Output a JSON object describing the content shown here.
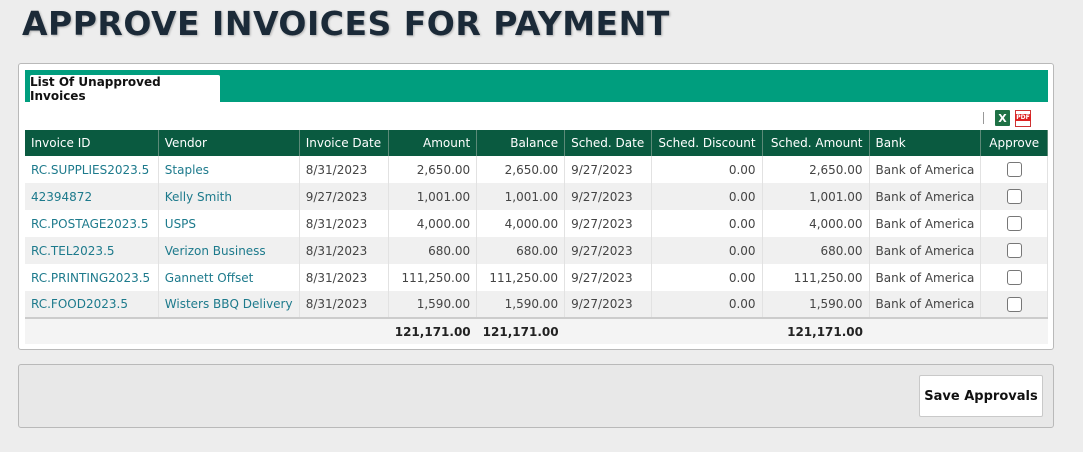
{
  "page": {
    "title": "APPROVE INVOICES FOR PAYMENT"
  },
  "tabs": [
    {
      "label": "List Of Unapproved Invoices"
    }
  ],
  "export": {
    "xls_icon": "excel-icon",
    "pdf_icon": "pdf-icon",
    "xls_glyph": "X",
    "pdf_glyph": "PDF"
  },
  "table": {
    "headers": {
      "invoice_id": "Invoice ID",
      "vendor": "Vendor",
      "invoice_date": "Invoice Date",
      "amount": "Amount",
      "balance": "Balance",
      "sched_date": "Sched. Date",
      "sched_discount": "Sched. Discount",
      "sched_amount": "Sched. Amount",
      "bank": "Bank",
      "approve": "Approve"
    },
    "rows": [
      {
        "invoice_id": "RC.SUPPLIES2023.5",
        "vendor": "Staples",
        "invoice_date": "8/31/2023",
        "amount": "2,650.00",
        "balance": "2,650.00",
        "sched_date": "9/27/2023",
        "sched_discount": "0.00",
        "sched_amount": "2,650.00",
        "bank": "Bank of America",
        "approved": false
      },
      {
        "invoice_id": "42394872",
        "vendor": "Kelly Smith",
        "invoice_date": "9/27/2023",
        "amount": "1,001.00",
        "balance": "1,001.00",
        "sched_date": "9/27/2023",
        "sched_discount": "0.00",
        "sched_amount": "1,001.00",
        "bank": "Bank of America",
        "approved": false
      },
      {
        "invoice_id": "RC.POSTAGE2023.5",
        "vendor": "USPS",
        "invoice_date": "8/31/2023",
        "amount": "4,000.00",
        "balance": "4,000.00",
        "sched_date": "9/27/2023",
        "sched_discount": "0.00",
        "sched_amount": "4,000.00",
        "bank": "Bank of America",
        "approved": false
      },
      {
        "invoice_id": "RC.TEL2023.5",
        "vendor": "Verizon Business",
        "invoice_date": "8/31/2023",
        "amount": "680.00",
        "balance": "680.00",
        "sched_date": "9/27/2023",
        "sched_discount": "0.00",
        "sched_amount": "680.00",
        "bank": "Bank of America",
        "approved": false
      },
      {
        "invoice_id": "RC.PRINTING2023.5",
        "vendor": "Gannett Offset",
        "invoice_date": "8/31/2023",
        "amount": "111,250.00",
        "balance": "111,250.00",
        "sched_date": "9/27/2023",
        "sched_discount": "0.00",
        "sched_amount": "111,250.00",
        "bank": "Bank of America",
        "approved": false
      },
      {
        "invoice_id": "RC.FOOD2023.5",
        "vendor": "Wisters BBQ Delivery",
        "invoice_date": "8/31/2023",
        "amount": "1,590.00",
        "balance": "1,590.00",
        "sched_date": "9/27/2023",
        "sched_discount": "0.00",
        "sched_amount": "1,590.00",
        "bank": "Bank of America",
        "approved": false
      }
    ],
    "totals": {
      "amount": "121,171.00",
      "balance": "121,171.00",
      "sched_amount": "121,171.00"
    }
  },
  "actions": {
    "save_label": "Save Approvals"
  }
}
